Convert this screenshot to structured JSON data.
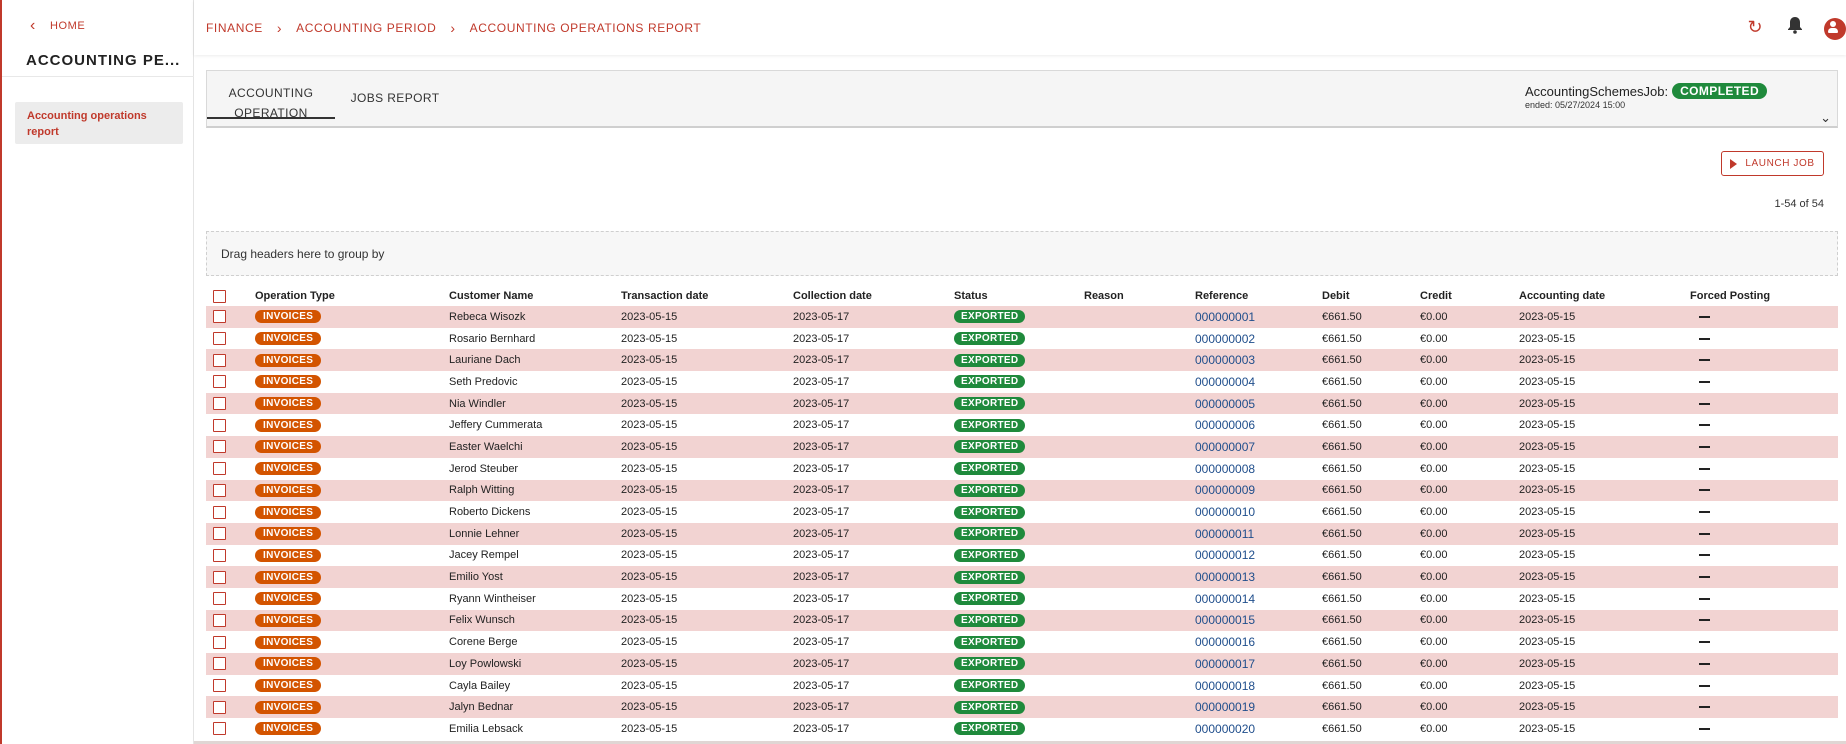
{
  "sidebar": {
    "home_label": "HOME",
    "title": "ACCOUNTING PE...",
    "items": [
      {
        "label": "Accounting operations report"
      }
    ]
  },
  "breadcrumb": [
    "FINANCE",
    "ACCOUNTING PERIOD",
    "ACCOUNTING OPERATIONS REPORT"
  ],
  "topbar_icons": [
    "refresh-icon",
    "bell-icon",
    "user-icon"
  ],
  "tabs": [
    {
      "label_line1": "ACCOUNTING",
      "label_line2": "OPERATION",
      "active": true
    },
    {
      "label": "JOBS REPORT",
      "active": false
    }
  ],
  "job": {
    "name": "AccountingSchemesJob:",
    "status": "COMPLETED",
    "ended": "ended: 05/27/2024 15:00"
  },
  "launch_button": "LAUNCH JOB",
  "pagination": "1-54 of 54",
  "group_zone": "Drag headers here to group by",
  "columns": [
    "Operation Type",
    "Customer Name",
    "Transaction date",
    "Collection date",
    "Status",
    "Reason",
    "Reference",
    "Debit",
    "Credit",
    "Accounting date",
    "Forced Posting"
  ],
  "rows": [
    {
      "type": "INVOICES",
      "customer": "Rebeca Wisozk",
      "tx": "2023-05-15",
      "coll": "2023-05-17",
      "status": "EXPORTED",
      "reason": "",
      "ref": "000000001",
      "debit": "€661.50",
      "credit": "€0.00",
      "acc": "2023-05-15"
    },
    {
      "type": "INVOICES",
      "customer": "Rosario Bernhard",
      "tx": "2023-05-15",
      "coll": "2023-05-17",
      "status": "EXPORTED",
      "reason": "",
      "ref": "000000002",
      "debit": "€661.50",
      "credit": "€0.00",
      "acc": "2023-05-15"
    },
    {
      "type": "INVOICES",
      "customer": "Lauriane Dach",
      "tx": "2023-05-15",
      "coll": "2023-05-17",
      "status": "EXPORTED",
      "reason": "",
      "ref": "000000003",
      "debit": "€661.50",
      "credit": "€0.00",
      "acc": "2023-05-15"
    },
    {
      "type": "INVOICES",
      "customer": "Seth Predovic",
      "tx": "2023-05-15",
      "coll": "2023-05-17",
      "status": "EXPORTED",
      "reason": "",
      "ref": "000000004",
      "debit": "€661.50",
      "credit": "€0.00",
      "acc": "2023-05-15"
    },
    {
      "type": "INVOICES",
      "customer": "Nia Windler",
      "tx": "2023-05-15",
      "coll": "2023-05-17",
      "status": "EXPORTED",
      "reason": "",
      "ref": "000000005",
      "debit": "€661.50",
      "credit": "€0.00",
      "acc": "2023-05-15"
    },
    {
      "type": "INVOICES",
      "customer": "Jeffery Cummerata",
      "tx": "2023-05-15",
      "coll": "2023-05-17",
      "status": "EXPORTED",
      "reason": "",
      "ref": "000000006",
      "debit": "€661.50",
      "credit": "€0.00",
      "acc": "2023-05-15"
    },
    {
      "type": "INVOICES",
      "customer": "Easter Waelchi",
      "tx": "2023-05-15",
      "coll": "2023-05-17",
      "status": "EXPORTED",
      "reason": "",
      "ref": "000000007",
      "debit": "€661.50",
      "credit": "€0.00",
      "acc": "2023-05-15"
    },
    {
      "type": "INVOICES",
      "customer": "Jerod Steuber",
      "tx": "2023-05-15",
      "coll": "2023-05-17",
      "status": "EXPORTED",
      "reason": "",
      "ref": "000000008",
      "debit": "€661.50",
      "credit": "€0.00",
      "acc": "2023-05-15"
    },
    {
      "type": "INVOICES",
      "customer": "Ralph Witting",
      "tx": "2023-05-15",
      "coll": "2023-05-17",
      "status": "EXPORTED",
      "reason": "",
      "ref": "000000009",
      "debit": "€661.50",
      "credit": "€0.00",
      "acc": "2023-05-15"
    },
    {
      "type": "INVOICES",
      "customer": "Roberto Dickens",
      "tx": "2023-05-15",
      "coll": "2023-05-17",
      "status": "EXPORTED",
      "reason": "",
      "ref": "000000010",
      "debit": "€661.50",
      "credit": "€0.00",
      "acc": "2023-05-15"
    },
    {
      "type": "INVOICES",
      "customer": "Lonnie Lehner",
      "tx": "2023-05-15",
      "coll": "2023-05-17",
      "status": "EXPORTED",
      "reason": "",
      "ref": "000000011",
      "debit": "€661.50",
      "credit": "€0.00",
      "acc": "2023-05-15"
    },
    {
      "type": "INVOICES",
      "customer": "Jacey Rempel",
      "tx": "2023-05-15",
      "coll": "2023-05-17",
      "status": "EXPORTED",
      "reason": "",
      "ref": "000000012",
      "debit": "€661.50",
      "credit": "€0.00",
      "acc": "2023-05-15"
    },
    {
      "type": "INVOICES",
      "customer": "Emilio Yost",
      "tx": "2023-05-15",
      "coll": "2023-05-17",
      "status": "EXPORTED",
      "reason": "",
      "ref": "000000013",
      "debit": "€661.50",
      "credit": "€0.00",
      "acc": "2023-05-15"
    },
    {
      "type": "INVOICES",
      "customer": "Ryann Wintheiser",
      "tx": "2023-05-15",
      "coll": "2023-05-17",
      "status": "EXPORTED",
      "reason": "",
      "ref": "000000014",
      "debit": "€661.50",
      "credit": "€0.00",
      "acc": "2023-05-15"
    },
    {
      "type": "INVOICES",
      "customer": "Felix Wunsch",
      "tx": "2023-05-15",
      "coll": "2023-05-17",
      "status": "EXPORTED",
      "reason": "",
      "ref": "000000015",
      "debit": "€661.50",
      "credit": "€0.00",
      "acc": "2023-05-15"
    },
    {
      "type": "INVOICES",
      "customer": "Corene Berge",
      "tx": "2023-05-15",
      "coll": "2023-05-17",
      "status": "EXPORTED",
      "reason": "",
      "ref": "000000016",
      "debit": "€661.50",
      "credit": "€0.00",
      "acc": "2023-05-15"
    },
    {
      "type": "INVOICES",
      "customer": "Loy Powlowski",
      "tx": "2023-05-15",
      "coll": "2023-05-17",
      "status": "EXPORTED",
      "reason": "",
      "ref": "000000017",
      "debit": "€661.50",
      "credit": "€0.00",
      "acc": "2023-05-15"
    },
    {
      "type": "INVOICES",
      "customer": "Cayla Bailey",
      "tx": "2023-05-15",
      "coll": "2023-05-17",
      "status": "EXPORTED",
      "reason": "",
      "ref": "000000018",
      "debit": "€661.50",
      "credit": "€0.00",
      "acc": "2023-05-15"
    },
    {
      "type": "INVOICES",
      "customer": "Jalyn Bednar",
      "tx": "2023-05-15",
      "coll": "2023-05-17",
      "status": "EXPORTED",
      "reason": "",
      "ref": "000000019",
      "debit": "€661.50",
      "credit": "€0.00",
      "acc": "2023-05-15"
    },
    {
      "type": "INVOICES",
      "customer": "Emilia Lebsack",
      "tx": "2023-05-15",
      "coll": "2023-05-17",
      "status": "EXPORTED",
      "reason": "",
      "ref": "000000020",
      "debit": "€661.50",
      "credit": "€0.00",
      "acc": "2023-05-15"
    }
  ],
  "colors": {
    "accent": "#c0392b",
    "invoice_pill": "#d35400",
    "exported_pill": "#1f8a3c",
    "row_stripe": "#f2d3d2",
    "reference_link": "#1f4e8c"
  }
}
